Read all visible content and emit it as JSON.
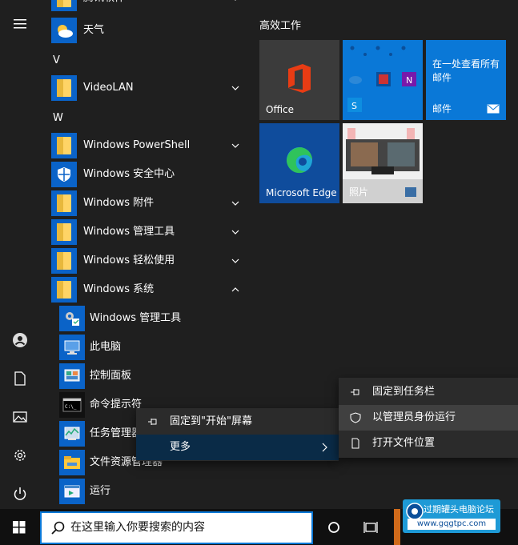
{
  "app_list": {
    "partial_top": "腾讯软件",
    "items": [
      {
        "label": "天气"
      },
      {
        "letter": "V"
      },
      {
        "label": "VideoLAN"
      },
      {
        "letter": "W"
      },
      {
        "label": "Windows PowerShell"
      },
      {
        "label": "Windows 安全中心"
      },
      {
        "label": "Windows 附件"
      },
      {
        "label": "Windows 管理工具"
      },
      {
        "label": "Windows 轻松使用"
      },
      {
        "label": "Windows 系统"
      }
    ],
    "sub_items": [
      {
        "label": "Windows 管理工具"
      },
      {
        "label": "此电脑"
      },
      {
        "label": "控制面板"
      },
      {
        "label": "命令提示符"
      },
      {
        "label": "任务管理器"
      },
      {
        "label": "文件资源管理器"
      },
      {
        "label": "运行"
      }
    ]
  },
  "tiles": {
    "group_title": "高效工作",
    "office": "Office",
    "mail_heading": "在一处查看所有邮件",
    "mail": "邮件",
    "edge": "Microsoft Edge",
    "photos": "照片"
  },
  "context_menu": {
    "pin_start": "固定到\"开始\"屏幕",
    "more": "更多"
  },
  "sub_menu": {
    "pin_taskbar": "固定到任务栏",
    "run_admin": "以管理员身份运行",
    "open_location": "打开文件位置"
  },
  "taskbar": {
    "search_placeholder": "在这里输入你要搜索的内容"
  },
  "watermark": {
    "line1": "过期罐头电脑论坛",
    "line2": "www.gqgtpc.com"
  },
  "colors": {
    "accent": "#0a63c8",
    "tile_blue": "#0a78d7",
    "office_bg": "#3b3b3b",
    "edge_bg": "#0f4c9c",
    "menu_bg": "#2b2b2b",
    "menu_hover": "#0a2b47",
    "menu_selected": "#404040"
  }
}
